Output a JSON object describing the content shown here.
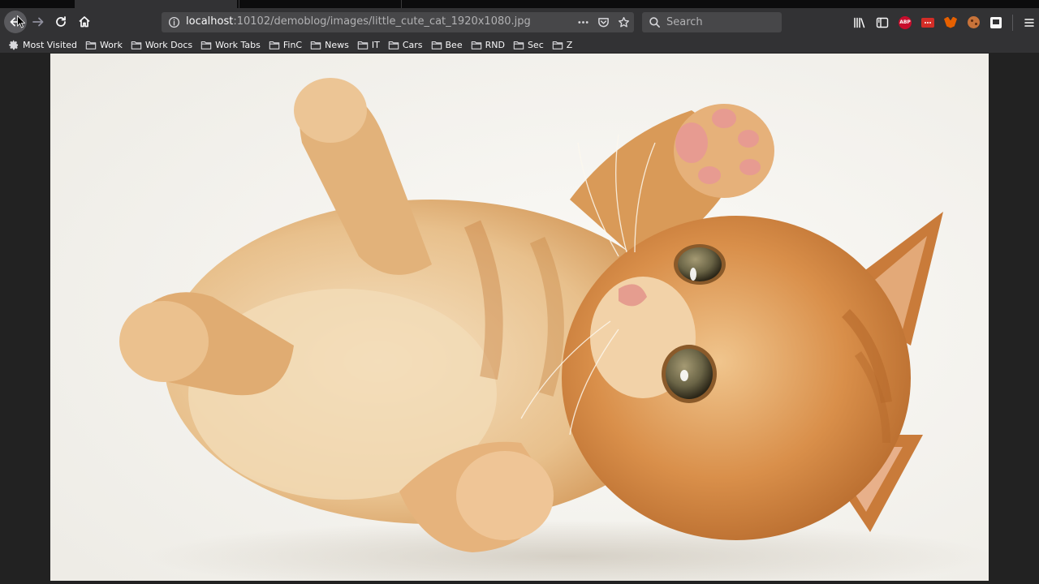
{
  "window": {
    "tabs": [
      "",
      "",
      ""
    ]
  },
  "navigation": {
    "url_host": "localhost",
    "url_path": ":10102/demoblog/images/little_cute_cat_1920x1080.jpg"
  },
  "search": {
    "placeholder": "Search"
  },
  "bookmarks": [
    {
      "label": "Most Visited",
      "icon": "gear-icon"
    },
    {
      "label": "Work",
      "icon": "folder-icon"
    },
    {
      "label": "Work Docs",
      "icon": "folder-icon"
    },
    {
      "label": "Work Tabs",
      "icon": "folder-icon"
    },
    {
      "label": "FinC",
      "icon": "folder-icon"
    },
    {
      "label": "News",
      "icon": "folder-icon"
    },
    {
      "label": "IT",
      "icon": "folder-icon"
    },
    {
      "label": "Cars",
      "icon": "folder-icon"
    },
    {
      "label": "Bee",
      "icon": "folder-icon"
    },
    {
      "label": "RND",
      "icon": "folder-icon"
    },
    {
      "label": "Sec",
      "icon": "folder-icon"
    },
    {
      "label": "Z",
      "icon": "folder-icon"
    }
  ],
  "extensions": {
    "abp_label": "ABP"
  },
  "image": {
    "subject": "orange-kitten-photo"
  },
  "colors": {
    "toolbar": "#323234",
    "urlbar": "#474749",
    "fur": "#d9a46a",
    "background": "#f7f6f3"
  }
}
